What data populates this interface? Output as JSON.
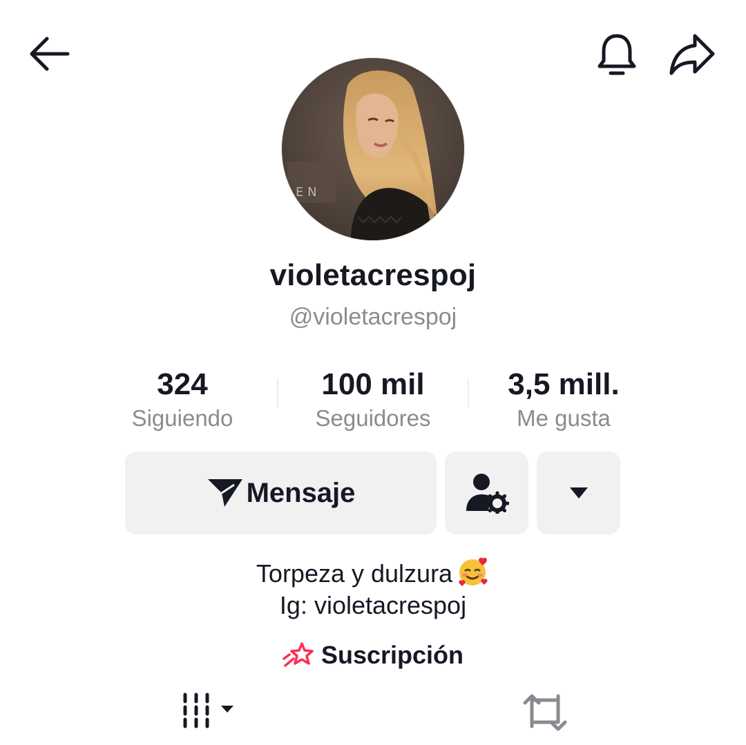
{
  "profile": {
    "display_name": "violetacrespoj",
    "handle": "@violetacrespoj"
  },
  "stats": [
    {
      "value": "324",
      "label": "Siguiendo"
    },
    {
      "value": "100 mil",
      "label": "Seguidores"
    },
    {
      "value": "3,5 mill.",
      "label": "Me gusta"
    }
  ],
  "actions": {
    "message_label": "Mensaje"
  },
  "bio": {
    "line1": "Torpeza y dulzura",
    "line1_emoji": "smiling-face-with-hearts",
    "line2": "Ig: violetacrespoj"
  },
  "subscription": {
    "label": "Suscripción",
    "icon": "shooting-star-icon",
    "icon_color": "#fe2c55"
  },
  "icons": {
    "top_bar": [
      "back-arrow-icon",
      "bell-icon",
      "share-icon"
    ],
    "tabs": [
      "grid-icon",
      "repost-icon"
    ]
  },
  "colors": {
    "primary_text": "#161823",
    "secondary_text": "#8a8b91",
    "button_bg": "#f1f1f2",
    "accent": "#fe2c55"
  }
}
